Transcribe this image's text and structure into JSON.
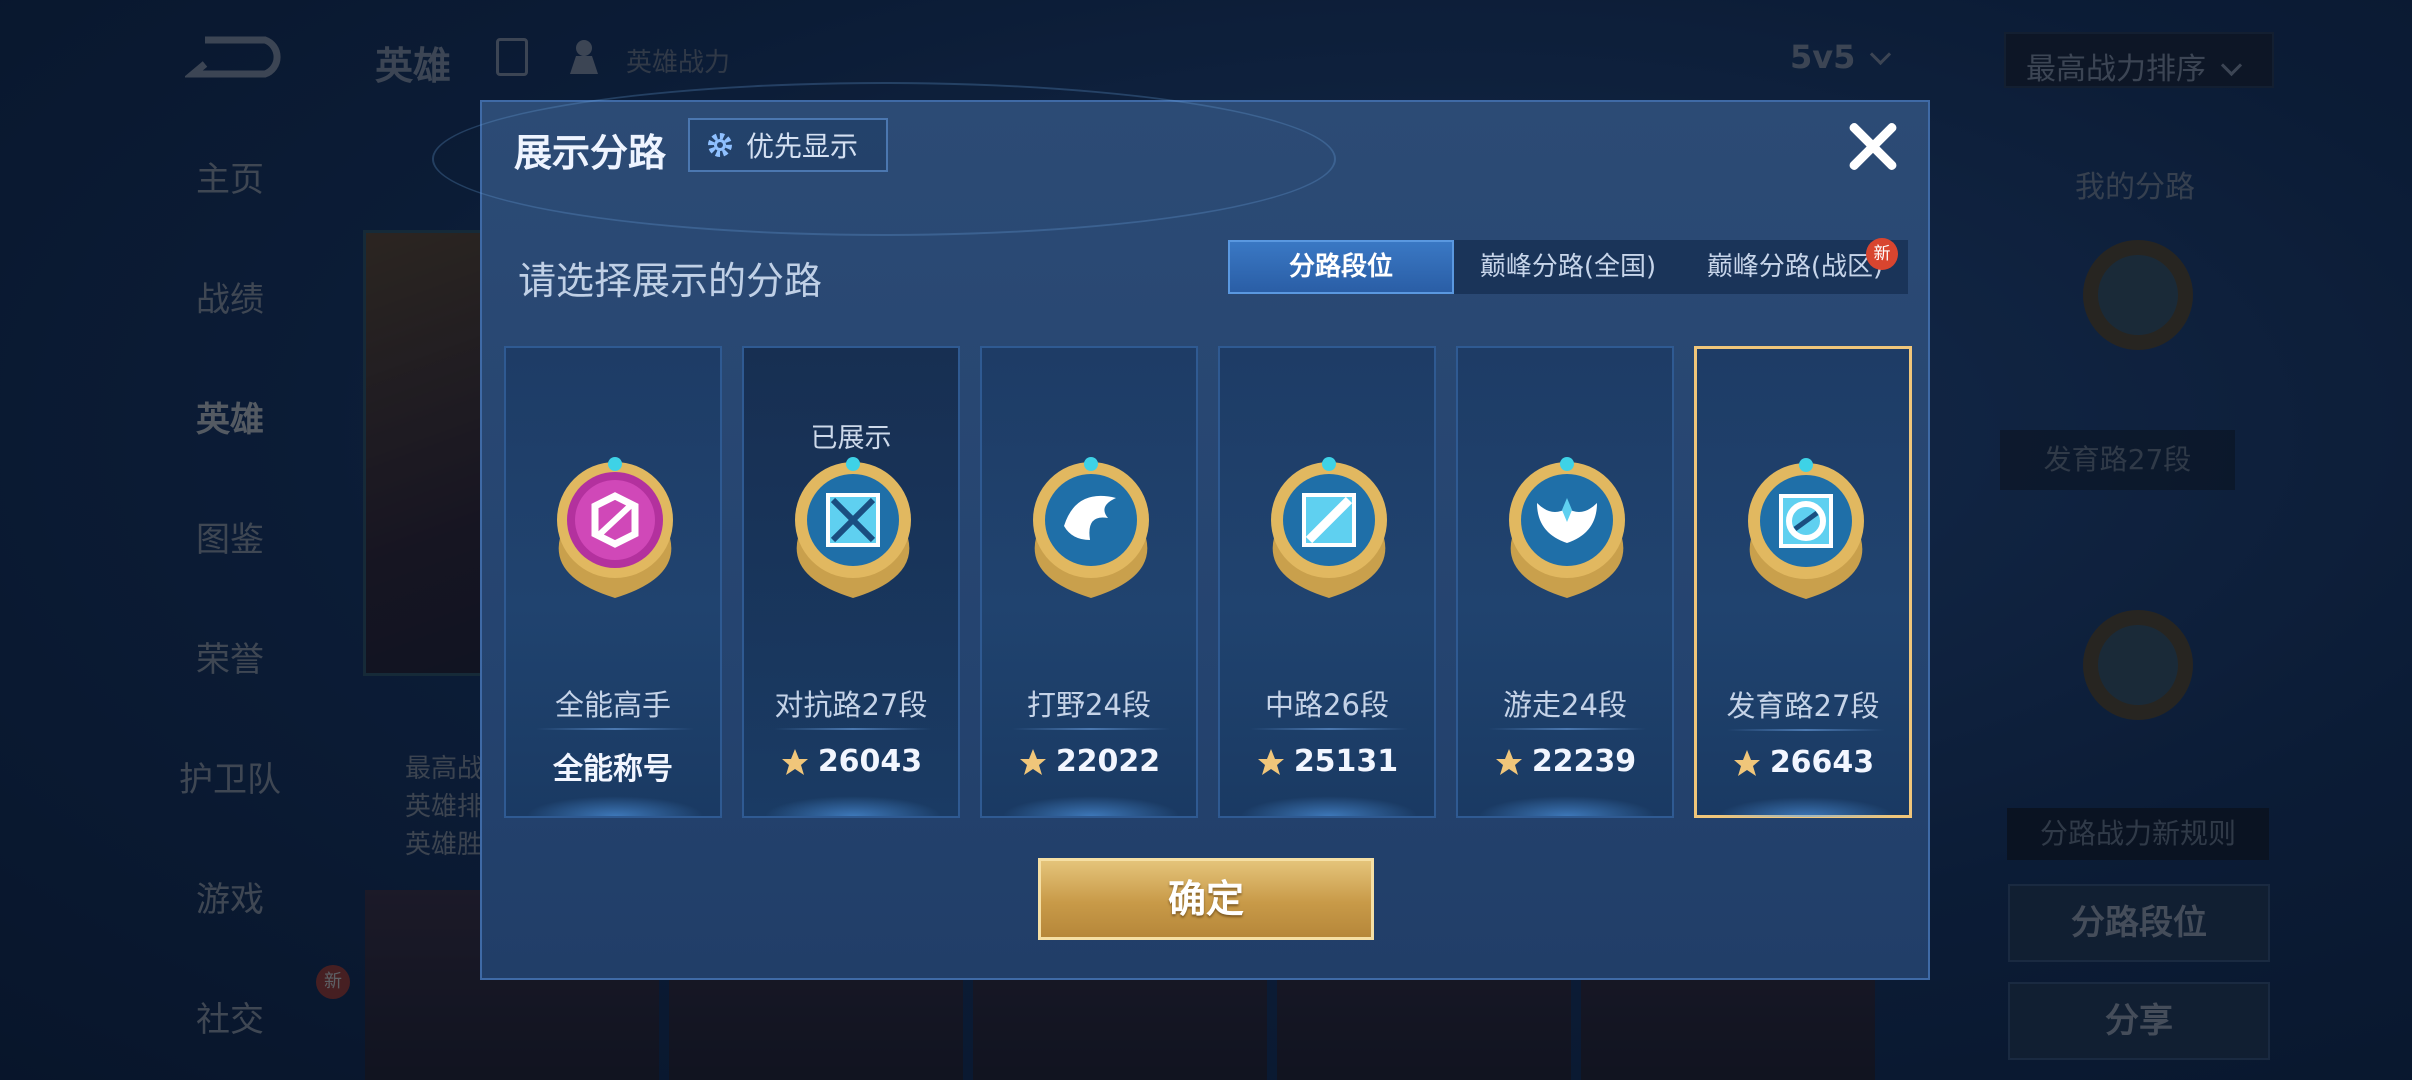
{
  "background": {
    "header": {
      "title": "英雄",
      "power_label": "英雄战力",
      "mode": "5v5",
      "sort": "最高战力排序"
    },
    "side_menu": [
      "主页",
      "战绩",
      "英雄",
      "图鉴",
      "荣誉",
      "护卫队",
      "游戏",
      "社交"
    ],
    "side_new_badge": "新",
    "hero_info": {
      "name_line1": "…",
      "line1": "最高战",
      "line2": "英雄排",
      "line3": "英雄胜"
    },
    "right_panel": {
      "title": "我的分路",
      "lane_label": "发育路27段",
      "rule": "分路战力新规则",
      "btn_lane": "分路段位",
      "btn_share": "分享"
    }
  },
  "modal": {
    "title": "展示分路",
    "priority_button": "优先显示",
    "subtitle": "请选择展示的分路",
    "tabs": [
      {
        "label": "分路段位",
        "active": true
      },
      {
        "label": "巅峰分路(全国)",
        "active": false
      },
      {
        "label": "巅峰分路(战区)",
        "active": false
      }
    ],
    "tab_new_badge": "新",
    "cards": [
      {
        "role": "全能高手",
        "score": "全能称号",
        "shown": "",
        "badge": "magenta",
        "has_icon": false
      },
      {
        "role": "对抗路27段",
        "score": "26043",
        "shown": "已展示",
        "badge": "clash",
        "has_icon": true
      },
      {
        "role": "打野24段",
        "score": "22022",
        "shown": "",
        "badge": "jungle",
        "has_icon": true
      },
      {
        "role": "中路26段",
        "score": "25131",
        "shown": "",
        "badge": "mid",
        "has_icon": true
      },
      {
        "role": "游走24段",
        "score": "22239",
        "shown": "",
        "badge": "roam",
        "has_icon": true
      },
      {
        "role": "发育路27段",
        "score": "26643",
        "shown": "",
        "badge": "farm",
        "has_icon": true,
        "selected": true
      }
    ],
    "confirm": "确定"
  },
  "colors": {
    "accent_gold": "#f0c67a",
    "tab_active": "#3a78c4",
    "new_badge": "#d8452f"
  }
}
